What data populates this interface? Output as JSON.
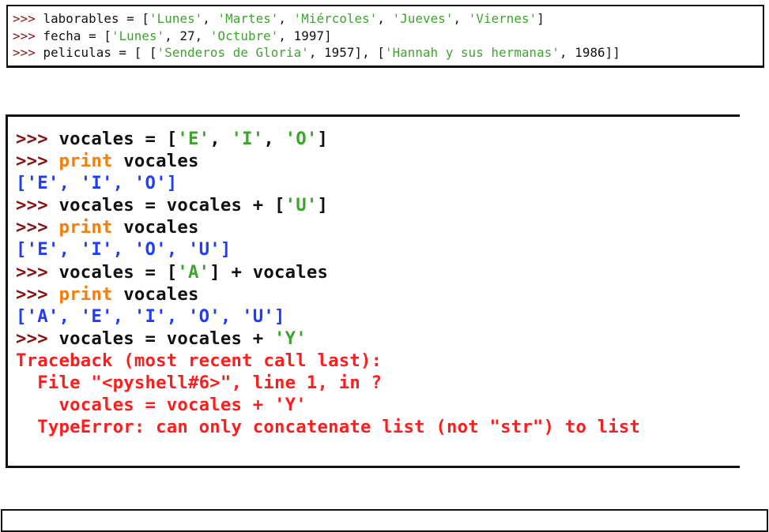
{
  "colors": {
    "prompt": "#8a1111",
    "code": "#111111",
    "string": "#3aa62a",
    "keyword": "#ff7a00",
    "output": "#1f3dff",
    "error": "#ff1c1c"
  },
  "top_panel": {
    "lines": [
      [
        {
          "t": ">>> ",
          "c": "prompt"
        },
        {
          "t": "laborables = [",
          "c": "code"
        },
        {
          "t": "'Lunes'",
          "c": "str"
        },
        {
          "t": ", ",
          "c": "code"
        },
        {
          "t": "'Martes'",
          "c": "str"
        },
        {
          "t": ", ",
          "c": "code"
        },
        {
          "t": "'Miércoles'",
          "c": "str"
        },
        {
          "t": ", ",
          "c": "code"
        },
        {
          "t": "'Jueves'",
          "c": "str"
        },
        {
          "t": ", ",
          "c": "code"
        },
        {
          "t": "'Viernes'",
          "c": "str"
        },
        {
          "t": "]",
          "c": "code"
        }
      ],
      [
        {
          "t": ">>> ",
          "c": "prompt"
        },
        {
          "t": "fecha = [",
          "c": "code"
        },
        {
          "t": "'Lunes'",
          "c": "str"
        },
        {
          "t": ", 27, ",
          "c": "code"
        },
        {
          "t": "'Octubre'",
          "c": "str"
        },
        {
          "t": ", 1997]",
          "c": "code"
        }
      ],
      [
        {
          "t": ">>> ",
          "c": "prompt"
        },
        {
          "t": "peliculas = [ [",
          "c": "code"
        },
        {
          "t": "'Senderos de Gloria'",
          "c": "str"
        },
        {
          "t": ", 1957], [",
          "c": "code"
        },
        {
          "t": "'Hannah y sus hermanas'",
          "c": "str"
        },
        {
          "t": ", 1986]]",
          "c": "code"
        }
      ]
    ]
  },
  "main_panel": {
    "lines": [
      [
        {
          "t": ">>> ",
          "c": "prompt"
        },
        {
          "t": "vocales = [",
          "c": "code"
        },
        {
          "t": "'E'",
          "c": "str"
        },
        {
          "t": ", ",
          "c": "code"
        },
        {
          "t": "'I'",
          "c": "str"
        },
        {
          "t": ", ",
          "c": "code"
        },
        {
          "t": "'O'",
          "c": "str"
        },
        {
          "t": "]",
          "c": "code"
        }
      ],
      [
        {
          "t": ">>> ",
          "c": "prompt"
        },
        {
          "t": "print",
          "c": "kw"
        },
        {
          "t": " vocales",
          "c": "code"
        }
      ],
      [
        {
          "t": "['E', 'I', 'O']",
          "c": "out"
        }
      ],
      [
        {
          "t": ">>> ",
          "c": "prompt"
        },
        {
          "t": "vocales = vocales + [",
          "c": "code"
        },
        {
          "t": "'U'",
          "c": "str"
        },
        {
          "t": "]",
          "c": "code"
        }
      ],
      [
        {
          "t": ">>> ",
          "c": "prompt"
        },
        {
          "t": "print",
          "c": "kw"
        },
        {
          "t": " vocales",
          "c": "code"
        }
      ],
      [
        {
          "t": "['E', 'I', 'O', 'U']",
          "c": "out"
        }
      ],
      [
        {
          "t": ">>> ",
          "c": "prompt"
        },
        {
          "t": "vocales = [",
          "c": "code"
        },
        {
          "t": "'A'",
          "c": "str"
        },
        {
          "t": "] + vocales",
          "c": "code"
        }
      ],
      [
        {
          "t": ">>> ",
          "c": "prompt"
        },
        {
          "t": "print",
          "c": "kw"
        },
        {
          "t": " vocales",
          "c": "code"
        }
      ],
      [
        {
          "t": "['A', 'E', 'I', 'O', 'U']",
          "c": "out"
        }
      ],
      [
        {
          "t": ">>> ",
          "c": "prompt"
        },
        {
          "t": "vocales = vocales + ",
          "c": "code"
        },
        {
          "t": "'Y'",
          "c": "str"
        }
      ],
      [
        {
          "t": "Traceback (most recent call last):",
          "c": "err"
        }
      ],
      [
        {
          "t": "  File \"<pyshell#6>\", line 1, in ?",
          "c": "err"
        }
      ],
      [
        {
          "t": "    vocales = vocales + 'Y'",
          "c": "err"
        }
      ],
      [
        {
          "t": "  TypeError: can only concatenate list (not \"str\") to list",
          "c": "err"
        }
      ]
    ]
  },
  "bottom_panel": {
    "text": ""
  }
}
